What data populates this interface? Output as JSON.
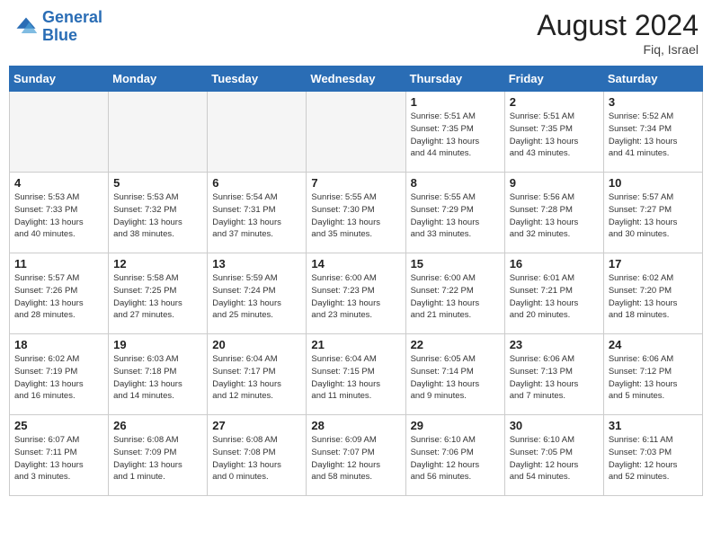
{
  "header": {
    "logo_line1": "General",
    "logo_line2": "Blue",
    "month_year": "August 2024",
    "location": "Fiq, Israel"
  },
  "weekdays": [
    "Sunday",
    "Monday",
    "Tuesday",
    "Wednesday",
    "Thursday",
    "Friday",
    "Saturday"
  ],
  "weeks": [
    [
      {
        "day": "",
        "info": "",
        "empty": true
      },
      {
        "day": "",
        "info": "",
        "empty": true
      },
      {
        "day": "",
        "info": "",
        "empty": true
      },
      {
        "day": "",
        "info": "",
        "empty": true
      },
      {
        "day": "1",
        "info": "Sunrise: 5:51 AM\nSunset: 7:35 PM\nDaylight: 13 hours\nand 44 minutes."
      },
      {
        "day": "2",
        "info": "Sunrise: 5:51 AM\nSunset: 7:35 PM\nDaylight: 13 hours\nand 43 minutes."
      },
      {
        "day": "3",
        "info": "Sunrise: 5:52 AM\nSunset: 7:34 PM\nDaylight: 13 hours\nand 41 minutes."
      }
    ],
    [
      {
        "day": "4",
        "info": "Sunrise: 5:53 AM\nSunset: 7:33 PM\nDaylight: 13 hours\nand 40 minutes."
      },
      {
        "day": "5",
        "info": "Sunrise: 5:53 AM\nSunset: 7:32 PM\nDaylight: 13 hours\nand 38 minutes."
      },
      {
        "day": "6",
        "info": "Sunrise: 5:54 AM\nSunset: 7:31 PM\nDaylight: 13 hours\nand 37 minutes."
      },
      {
        "day": "7",
        "info": "Sunrise: 5:55 AM\nSunset: 7:30 PM\nDaylight: 13 hours\nand 35 minutes."
      },
      {
        "day": "8",
        "info": "Sunrise: 5:55 AM\nSunset: 7:29 PM\nDaylight: 13 hours\nand 33 minutes."
      },
      {
        "day": "9",
        "info": "Sunrise: 5:56 AM\nSunset: 7:28 PM\nDaylight: 13 hours\nand 32 minutes."
      },
      {
        "day": "10",
        "info": "Sunrise: 5:57 AM\nSunset: 7:27 PM\nDaylight: 13 hours\nand 30 minutes."
      }
    ],
    [
      {
        "day": "11",
        "info": "Sunrise: 5:57 AM\nSunset: 7:26 PM\nDaylight: 13 hours\nand 28 minutes."
      },
      {
        "day": "12",
        "info": "Sunrise: 5:58 AM\nSunset: 7:25 PM\nDaylight: 13 hours\nand 27 minutes."
      },
      {
        "day": "13",
        "info": "Sunrise: 5:59 AM\nSunset: 7:24 PM\nDaylight: 13 hours\nand 25 minutes."
      },
      {
        "day": "14",
        "info": "Sunrise: 6:00 AM\nSunset: 7:23 PM\nDaylight: 13 hours\nand 23 minutes."
      },
      {
        "day": "15",
        "info": "Sunrise: 6:00 AM\nSunset: 7:22 PM\nDaylight: 13 hours\nand 21 minutes."
      },
      {
        "day": "16",
        "info": "Sunrise: 6:01 AM\nSunset: 7:21 PM\nDaylight: 13 hours\nand 20 minutes."
      },
      {
        "day": "17",
        "info": "Sunrise: 6:02 AM\nSunset: 7:20 PM\nDaylight: 13 hours\nand 18 minutes."
      }
    ],
    [
      {
        "day": "18",
        "info": "Sunrise: 6:02 AM\nSunset: 7:19 PM\nDaylight: 13 hours\nand 16 minutes."
      },
      {
        "day": "19",
        "info": "Sunrise: 6:03 AM\nSunset: 7:18 PM\nDaylight: 13 hours\nand 14 minutes."
      },
      {
        "day": "20",
        "info": "Sunrise: 6:04 AM\nSunset: 7:17 PM\nDaylight: 13 hours\nand 12 minutes."
      },
      {
        "day": "21",
        "info": "Sunrise: 6:04 AM\nSunset: 7:15 PM\nDaylight: 13 hours\nand 11 minutes."
      },
      {
        "day": "22",
        "info": "Sunrise: 6:05 AM\nSunset: 7:14 PM\nDaylight: 13 hours\nand 9 minutes."
      },
      {
        "day": "23",
        "info": "Sunrise: 6:06 AM\nSunset: 7:13 PM\nDaylight: 13 hours\nand 7 minutes."
      },
      {
        "day": "24",
        "info": "Sunrise: 6:06 AM\nSunset: 7:12 PM\nDaylight: 13 hours\nand 5 minutes."
      }
    ],
    [
      {
        "day": "25",
        "info": "Sunrise: 6:07 AM\nSunset: 7:11 PM\nDaylight: 13 hours\nand 3 minutes."
      },
      {
        "day": "26",
        "info": "Sunrise: 6:08 AM\nSunset: 7:09 PM\nDaylight: 13 hours\nand 1 minute."
      },
      {
        "day": "27",
        "info": "Sunrise: 6:08 AM\nSunset: 7:08 PM\nDaylight: 13 hours\nand 0 minutes."
      },
      {
        "day": "28",
        "info": "Sunrise: 6:09 AM\nSunset: 7:07 PM\nDaylight: 12 hours\nand 58 minutes."
      },
      {
        "day": "29",
        "info": "Sunrise: 6:10 AM\nSunset: 7:06 PM\nDaylight: 12 hours\nand 56 minutes."
      },
      {
        "day": "30",
        "info": "Sunrise: 6:10 AM\nSunset: 7:05 PM\nDaylight: 12 hours\nand 54 minutes."
      },
      {
        "day": "31",
        "info": "Sunrise: 6:11 AM\nSunset: 7:03 PM\nDaylight: 12 hours\nand 52 minutes."
      }
    ]
  ]
}
